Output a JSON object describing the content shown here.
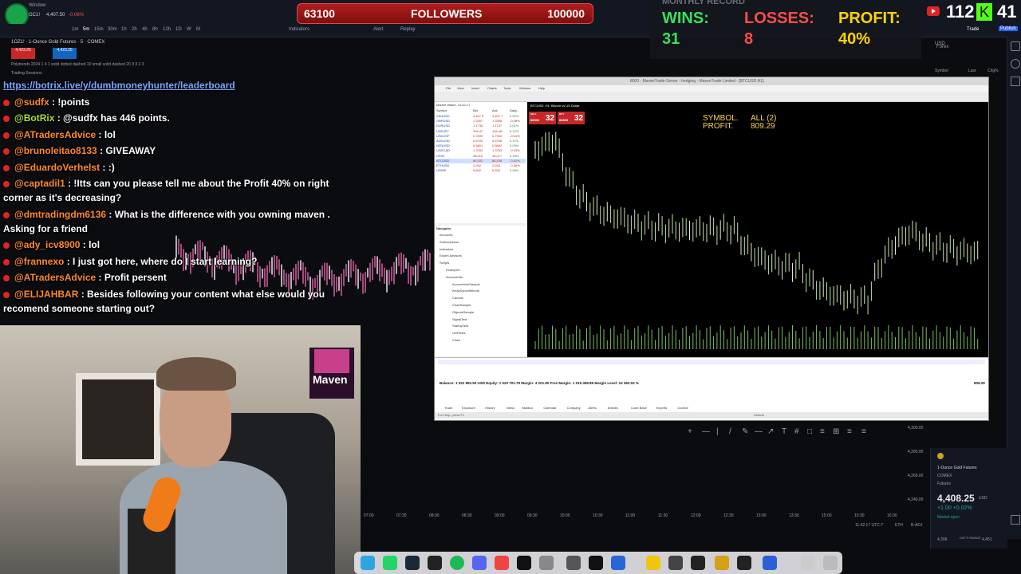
{
  "tv": {
    "window_title": "Window",
    "top_symbol": "GC1!",
    "top_price": "4,407.50",
    "top_change": "-0.06%",
    "toolbar": [
      "1m",
      "5m",
      "15m",
      "30m",
      "1h",
      "2h",
      "4h",
      "8h",
      "12h",
      "1D",
      "W",
      "M",
      "Indicators",
      "Alert",
      "Replay"
    ],
    "symbol_line": "1OZ1! · 1-Ounce Gold Futures · 5 · COMEX",
    "sell_price": "4,423.25",
    "buy_price": "4,423.25",
    "indicator_line": "Polytrends 2024 1 4 1 solid dotted dashed 10 small solid dashed 20 3 3 2 3",
    "sessions_label": "Trading Sessions",
    "right_labels": [
      "USD",
      "Forex",
      "Symbol",
      "Last",
      "Chg%"
    ],
    "trade_label": "Trade",
    "publish_label": "Publish",
    "price_ticks": [
      "4,300.00",
      "4,280.00",
      "4,260.00",
      "4,240.00"
    ],
    "time_ticks": [
      "07:00",
      "07:30",
      "08:00",
      "08:30",
      "09:00",
      "09:30",
      "10:00",
      "10:30",
      "11:00",
      "11:30",
      "12:00",
      "12:30",
      "13:00",
      "13:30",
      "15:00",
      "15:30",
      "16:00"
    ],
    "status_time": "11:42:17 UTC-7",
    "status_session": "ETH",
    "status_adj": "B-ADJ",
    "quote": {
      "title": "1-Ounce Gold Futures",
      "exchange": "COMEX",
      "kind": "Futures",
      "price": "4,408.25",
      "currency": "USD",
      "change": "+1.00 +0.02%",
      "market": "Market open",
      "low": "4,306",
      "high": "4,451",
      "range_label": "DAY'S RANGE"
    }
  },
  "followers": {
    "current": "63100",
    "label": "FOLLOWERS",
    "goal": "100000"
  },
  "record": {
    "title": "MONTHLY RECORD",
    "wins_label": "WINS:",
    "wins": "31",
    "losses_label": "LOSSES:",
    "losses": "8",
    "profit_label": "PROFIT:",
    "profit": "40%"
  },
  "counters": {
    "youtube": "112",
    "kick": "41"
  },
  "chat": {
    "url": "https://botrix.live/y/dumbmoneyhunter/leaderboard",
    "messages": [
      {
        "user": "@sudfx",
        "text": " : !points"
      },
      {
        "user": "@BotRix",
        "text": " : @sudfx has 446 points."
      },
      {
        "user": "@ATradersAdvice",
        "text": " : lol"
      },
      {
        "user": "@bruno​leitao8133",
        "text": " : GIVEAWAY"
      },
      {
        "user": "@EduardoVerhelst",
        "text": " : :)"
      },
      {
        "user": "@captadil1",
        "text": " : !Itts can you please tell me about the Profit 40% on right"
      },
      {
        "user": "",
        "text": "corner as it's decreasing?"
      },
      {
        "user": "@dmtradingdm6136",
        "text": " : What is the difference with you owning maven ."
      },
      {
        "user": "",
        "text": "Asking for a friend"
      },
      {
        "user": "@ady_icv8900",
        "text": " : lol"
      },
      {
        "user": "@frannexo",
        "text": " : I just got here, where do I start learning?"
      },
      {
        "user": "@ATradersAdvice",
        "text": " : Profit persent"
      },
      {
        "user": "@ELIJAHBAR",
        "text": " : Besides following your content what else would you"
      },
      {
        "user": "",
        "text": "recomend someone starting out?"
      }
    ]
  },
  "webcam": {
    "poster_text": "Maven"
  },
  "mt": {
    "title": "8000 - MavenTrade-Server - hedging - MavenTrade Limited - [BTCUSD,H1]",
    "menu": [
      "File",
      "View",
      "Insert",
      "Charts",
      "Tools",
      "Window",
      "Help"
    ],
    "watch_header": "Market Watch: 10:42:17",
    "watch_cols": [
      "Symbol",
      "Bid",
      "Ask",
      "Daily..."
    ],
    "watch_rows": [
      [
        "XAUUSD",
        "4,407.5",
        "4,407.7",
        "0.02%"
      ],
      [
        "GBPUSD",
        "1.3397",
        "1.3398",
        "-0.08%"
      ],
      [
        "EURUSD",
        "1.1736",
        "1.1737",
        "0.01%"
      ],
      [
        "USDJPY",
        "156.47",
        "156.48",
        "0.12%"
      ],
      [
        "USDCHF",
        "0.7899",
        "0.7900",
        "-0.04%"
      ],
      [
        "AUDUSD",
        "0.6705",
        "0.6706",
        "0.11%"
      ],
      [
        "NZDUSD",
        "0.5801",
        "0.5802",
        "0.09%"
      ],
      [
        "USDCAD",
        "1.3782",
        "1.3783",
        "-0.03%"
      ],
      [
        "US30",
        "48,015",
        "48,017",
        "0.18%"
      ],
      [
        "BTCUSD",
        "86,532",
        "86,538",
        "-0.42%"
      ],
      [
        "ETHUSD",
        "2,932",
        "2,933",
        "-0.36%"
      ],
      [
        "US500",
        "6,842",
        "6,843",
        "0.09%"
      ]
    ],
    "nav_header": "Navigator",
    "nav_items": [
      "Accounts",
      "Subscriptions",
      "Indicators",
      "Expert Advisors",
      "Scripts",
      "Examples",
      "AccountInfo",
      "AccountInfoSample",
      "ArraySyncMethods",
      "Canvas",
      "ChartSample",
      "ObjectsSample",
      "SignalTest",
      "StartupTest",
      "UnitTests",
      "Chart"
    ],
    "chart_symbol": "BTCUSD, H1: Bitcoin vs US Dollar",
    "sell_label": "SELL",
    "sell_big": "32",
    "buy_label": "BUY",
    "buy_big": "32",
    "sell_small": "86532",
    "buy_small": "86538",
    "symbol_label": "SYMBOL.",
    "symbol_value": "ALL (2)",
    "profit_label": "PROFIT.",
    "profit_value": "809.29",
    "balance_line": "Balance: 1 022 892.50 USD  Equity: 1 023 701.79  Margin: 4 201.90  Free Margin: 1 019 499.89  Margin Level: 24 362.03 %",
    "balance_profit": "809.29",
    "tabs": [
      "Trade",
      "Exposure",
      "History",
      "News",
      "Mailbox",
      "Calendar",
      "Company",
      "Alerts",
      "Articles",
      "Code Base",
      "Experts",
      "Journal"
    ],
    "status_left": "For Help, press F1",
    "status_mid": "Default"
  }
}
